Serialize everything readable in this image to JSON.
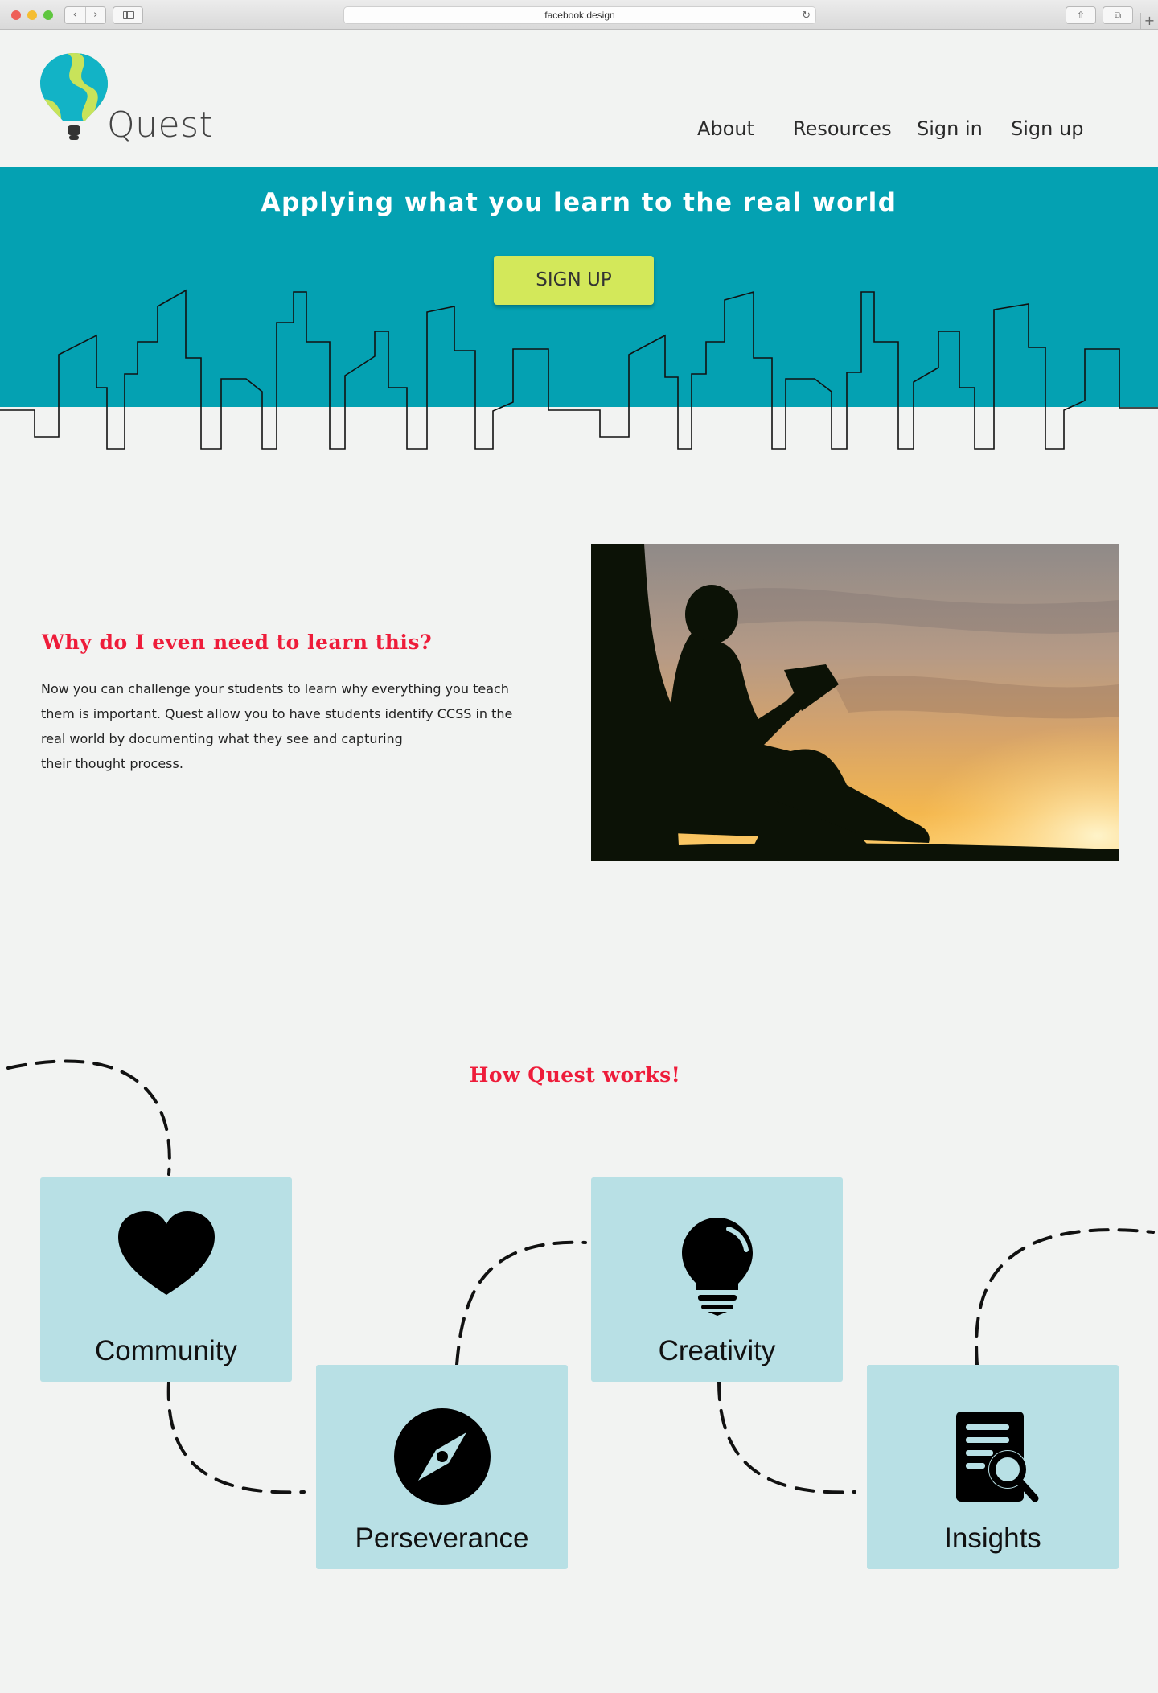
{
  "browser": {
    "url": "facebook.design",
    "traffic_light_colors": [
      "#ee5f58",
      "#f5bd31",
      "#5fc63f"
    ],
    "icons": [
      "back-icon",
      "forward-icon",
      "sidebar-icon",
      "reload-icon",
      "share-icon",
      "tabs-icon",
      "new-tab-icon"
    ]
  },
  "header": {
    "brand": "Quest",
    "nav": [
      "About",
      "Resources",
      "Sign in",
      "Sign up"
    ]
  },
  "hero": {
    "title": "Applying what you learn to the real world",
    "cta": "SIGN UP",
    "background": "#04a1b2",
    "cta_color": "#d3e85a"
  },
  "why": {
    "title": "Why do I even need to learn this?",
    "lines": [
      "Now you can challenge your students to learn why everything you teach",
      "them is important. Quest allow you to have students identify CCSS in the",
      "real world by documenting what they see and capturing",
      "their thought process."
    ],
    "photo": "child-reading-silhouette-at-sunset"
  },
  "how": {
    "title": "How Quest works!",
    "accent": "#ee1c3a",
    "card_color": "#b8e0e5",
    "cards": [
      {
        "label": "Community",
        "icon": "heart-icon"
      },
      {
        "label": "Perseverance",
        "icon": "compass-icon"
      },
      {
        "label": "Creativity",
        "icon": "lightbulb-icon"
      },
      {
        "label": "Insights",
        "icon": "document-search-icon"
      }
    ]
  }
}
